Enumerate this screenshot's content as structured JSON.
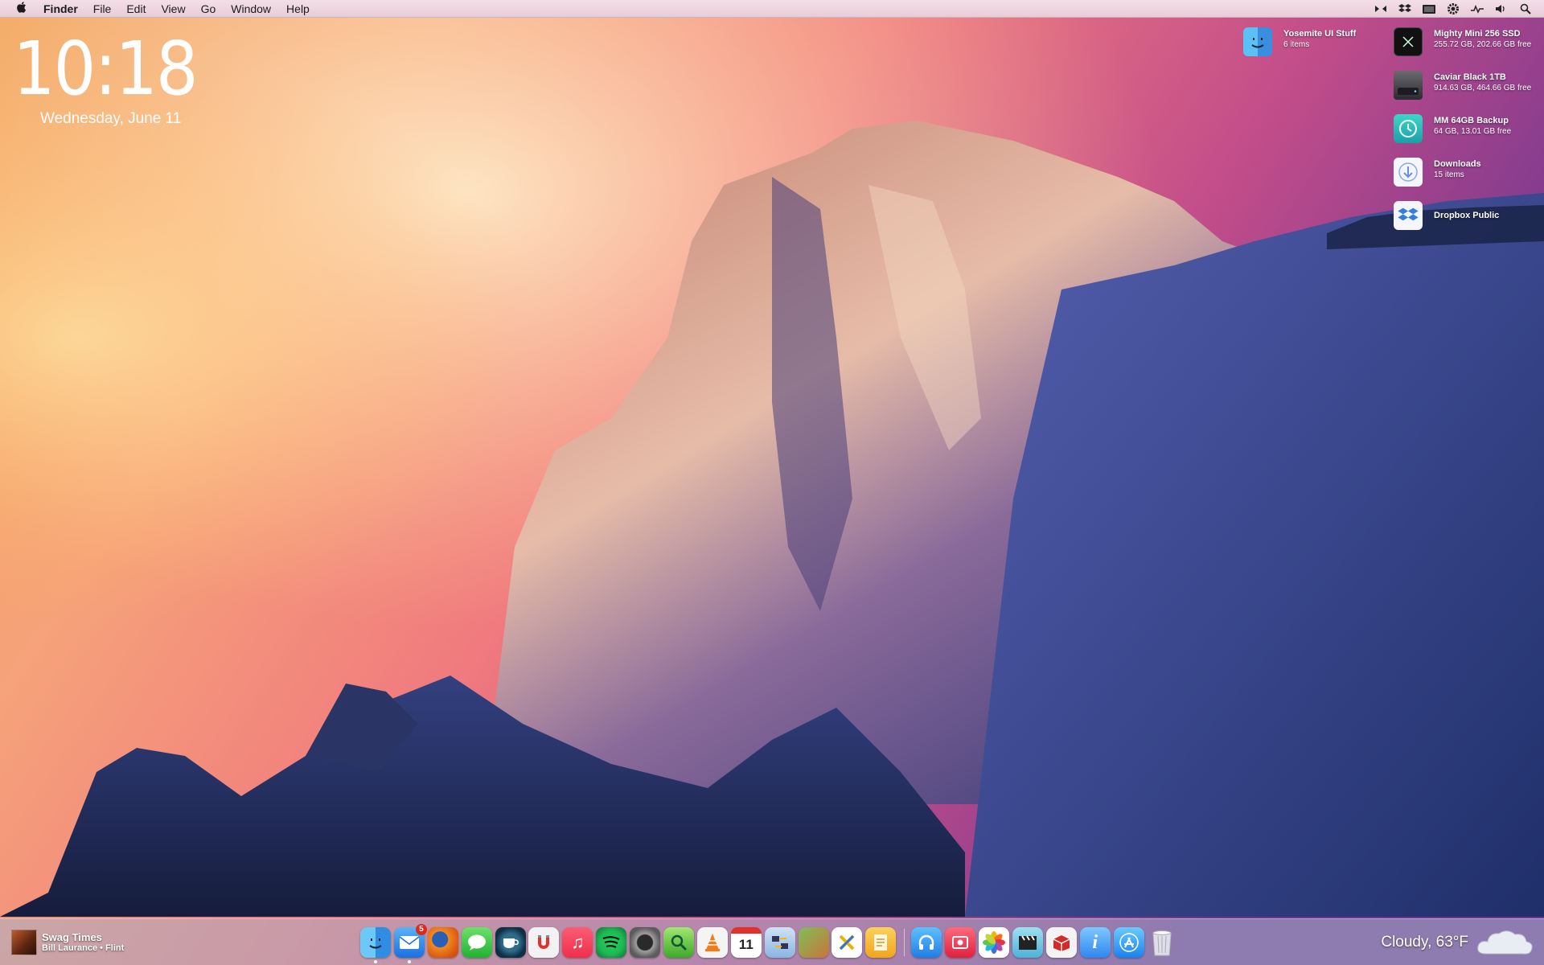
{
  "menubar": {
    "apple_icon": "apple-logo-icon",
    "app_name": "Finder",
    "items": [
      "File",
      "Edit",
      "View",
      "Go",
      "Window",
      "Help"
    ],
    "status_icons": [
      "dual-arrows-icon",
      "dropbox-icon",
      "screen-icon",
      "gear-icon",
      "activity-icon",
      "volume-icon",
      "spotlight-search-icon"
    ]
  },
  "clock": {
    "time": "10:18",
    "date": "Wednesday, June 11"
  },
  "desktop": {
    "folders": [
      {
        "name": "Yosemite UI Stuff",
        "sub": "6 items",
        "icon": "finder-folder-icon"
      }
    ],
    "volumes": [
      {
        "name": "Mighty Mini 256 SSD",
        "sub": "255.72 GB, 202.66 GB free",
        "icon": "x-drive-icon"
      },
      {
        "name": "Caviar Black 1TB",
        "sub": "914.63 GB, 464.66 GB free",
        "icon": "hard-drive-icon"
      },
      {
        "name": "MM 64GB Backup",
        "sub": "64 GB, 13.01 GB free",
        "icon": "time-machine-icon"
      },
      {
        "name": "Downloads",
        "sub": "15 items",
        "icon": "downloads-folder-icon"
      },
      {
        "name": "Dropbox Public",
        "sub": "",
        "icon": "dropbox-folder-icon"
      }
    ]
  },
  "now_playing": {
    "track": "Swag Times",
    "artist": "Bill Laurance • Flint"
  },
  "dock": {
    "mail_badge": "5",
    "calendar_day": "11",
    "apps": [
      "finder",
      "mail",
      "firefox",
      "messages",
      "caffeine",
      "magnet",
      "itunes",
      "spotify",
      "camera",
      "finder-search",
      "vlc",
      "calendar",
      "migration",
      "image-app",
      "x-app",
      "notes",
      "headphones",
      "photo-booth",
      "photos",
      "clapper",
      "boxes",
      "info",
      "app-store",
      "trash"
    ]
  },
  "weather": {
    "text": "Cloudy, 63°F",
    "icon": "cloud-icon"
  },
  "colors": {
    "menubar": "#efd8e2",
    "dock_bar": "#aab4c8"
  }
}
